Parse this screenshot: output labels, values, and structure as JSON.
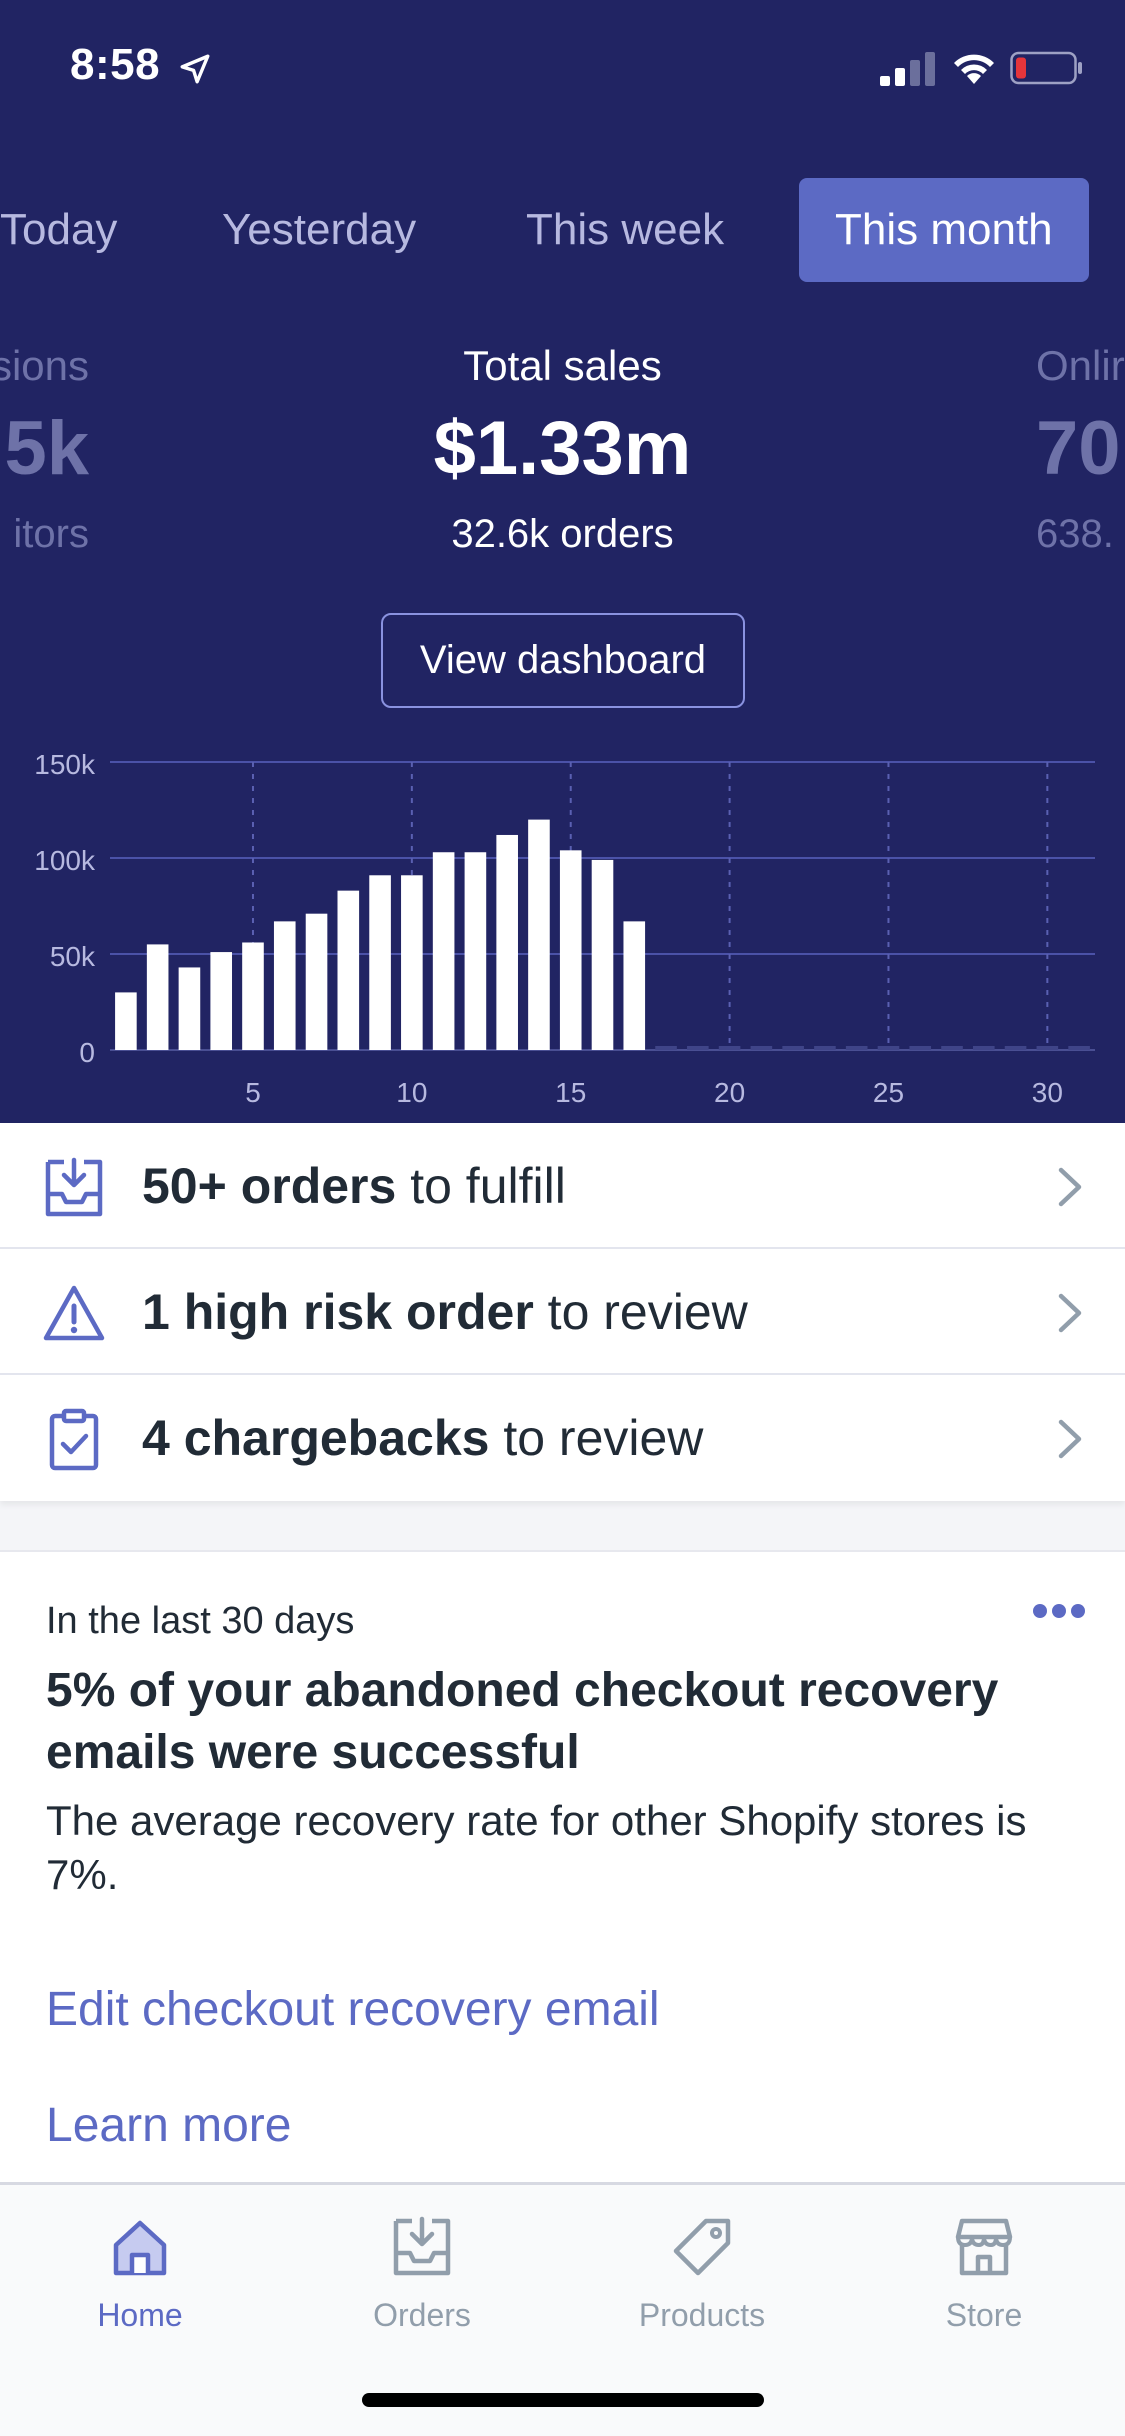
{
  "status_bar": {
    "time": "8:58",
    "icons": [
      "location-arrow-icon",
      "cellular-signal-icon",
      "wifi-icon",
      "battery-low-icon"
    ],
    "battery_color": "#e5353b"
  },
  "colors": {
    "header_bg": "#212463",
    "accent": "#5c6ac4",
    "text_dark": "#212b36",
    "text_muted": "#919eab"
  },
  "period_tabs": [
    {
      "label": "Today",
      "active": false
    },
    {
      "label": "Yesterday",
      "active": false
    },
    {
      "label": "This week",
      "active": false
    },
    {
      "label": "This month",
      "active": true
    }
  ],
  "metrics": {
    "left_partial": {
      "label": "sions",
      "value": "5k",
      "sub": "itors"
    },
    "center": {
      "label": "Total sales",
      "value": "$1.33m",
      "sub": "32.6k orders"
    },
    "right_partial": {
      "label": "Onlir",
      "value": "70",
      "sub": "638."
    }
  },
  "view_dashboard_label": "View dashboard",
  "chart_data": {
    "type": "bar",
    "x": [
      1,
      2,
      3,
      4,
      5,
      6,
      7,
      8,
      9,
      10,
      11,
      12,
      13,
      14,
      15,
      16,
      17,
      18,
      19,
      20,
      21,
      22,
      23,
      24,
      25,
      26,
      27,
      28,
      29,
      30,
      31
    ],
    "values": [
      30000,
      55000,
      43000,
      51000,
      56000,
      67000,
      71000,
      83000,
      91000,
      91000,
      103000,
      103000,
      112000,
      120000,
      104000,
      99000,
      67000,
      0,
      0,
      0,
      0,
      0,
      0,
      0,
      0,
      0,
      0,
      0,
      0,
      0,
      0
    ],
    "x_ticks": [
      "5",
      "10",
      "15",
      "20",
      "25",
      "30"
    ],
    "y_ticks": [
      "0",
      "50k",
      "100k",
      "150k"
    ],
    "ylim": [
      0,
      150000
    ],
    "grid": true,
    "bar_color": "#ffffff"
  },
  "actions": [
    {
      "icon": "inbox-download-icon",
      "bold": "50+ orders",
      "rest": " to fulfill"
    },
    {
      "icon": "warning-triangle-icon",
      "bold": "1 high risk order",
      "rest": " to review"
    },
    {
      "icon": "clipboard-check-icon",
      "bold": "4 chargebacks",
      "rest": " to review"
    }
  ],
  "insight_card": {
    "meta": "In the last 30 days",
    "title": "5% of your abandoned checkout recovery emails were successful",
    "body": "The average recovery rate for other Shopify stores is 7%.",
    "link_primary": "Edit checkout recovery email",
    "link_secondary": "Learn more"
  },
  "tab_bar": [
    {
      "label": "Home",
      "icon": "home-icon",
      "active": true
    },
    {
      "label": "Orders",
      "icon": "orders-inbox-icon",
      "active": false
    },
    {
      "label": "Products",
      "icon": "tag-icon",
      "active": false
    },
    {
      "label": "Store",
      "icon": "storefront-icon",
      "active": false
    }
  ]
}
